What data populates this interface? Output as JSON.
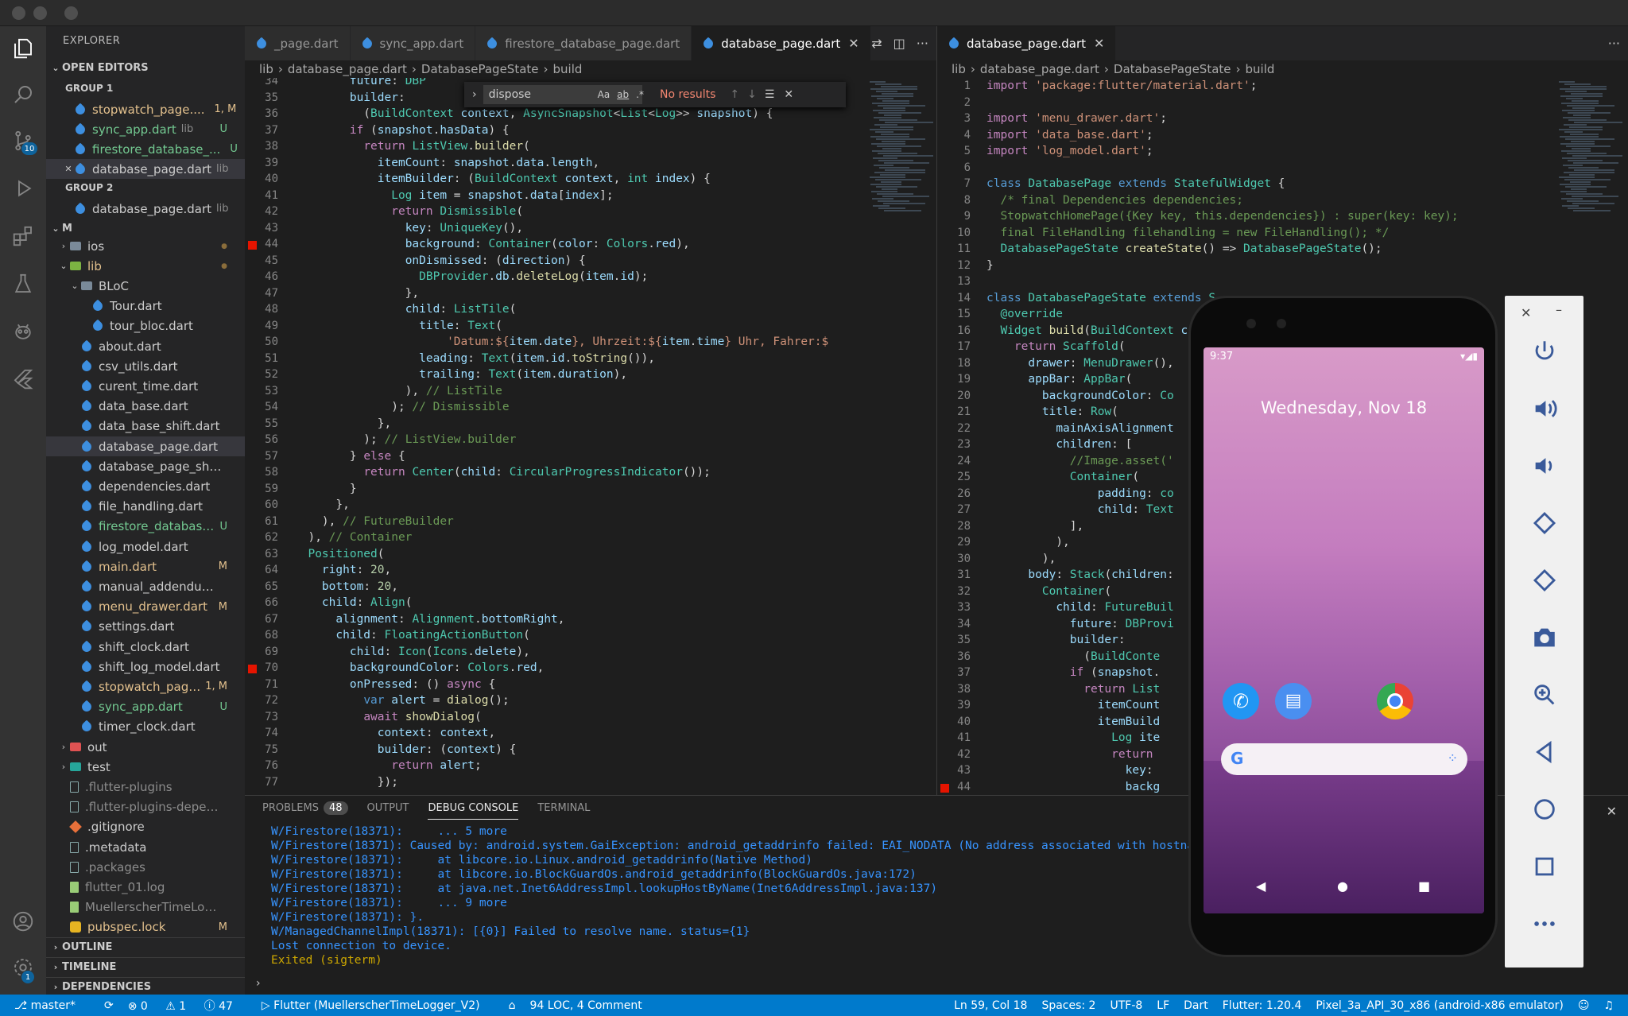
{
  "explorer": {
    "title": "EXPLORER",
    "open_editors": "OPEN EDITORS",
    "group1": "GROUP 1",
    "group2": "GROUP 2",
    "root": "M",
    "open_g1": [
      {
        "label": "stopwatch_page....",
        "desc": "",
        "badge": "1, M",
        "color": "mod",
        "close": false
      },
      {
        "label": "sync_app.dart",
        "desc": "lib",
        "badge": "U",
        "color": "un",
        "close": false
      },
      {
        "label": "firestore_database_...",
        "desc": "",
        "badge": "U",
        "color": "un",
        "close": false
      },
      {
        "label": "database_page.dart",
        "desc": "lib",
        "badge": "",
        "color": "",
        "close": true
      }
    ],
    "open_g2": [
      {
        "label": "database_page.dart",
        "desc": "lib"
      }
    ],
    "tree": [
      {
        "label": "ios",
        "icon": "folder",
        "indent": 1,
        "tw": "›",
        "badge": "●",
        "color": ""
      },
      {
        "label": "lib",
        "icon": "folderg",
        "indent": 1,
        "tw": "⌄",
        "badge": "●",
        "color": "mod"
      },
      {
        "label": "BLoC",
        "icon": "folder",
        "indent": 2,
        "tw": "⌄",
        "badge": "",
        "color": ""
      },
      {
        "label": "Tour.dart",
        "icon": "dart",
        "indent": 3,
        "badge": "",
        "color": ""
      },
      {
        "label": "tour_bloc.dart",
        "icon": "dart",
        "indent": 3,
        "badge": "",
        "color": ""
      },
      {
        "label": "about.dart",
        "icon": "dart",
        "indent": 2,
        "badge": "",
        "color": ""
      },
      {
        "label": "csv_utils.dart",
        "icon": "dart",
        "indent": 2,
        "badge": "",
        "color": ""
      },
      {
        "label": "curent_time.dart",
        "icon": "dart",
        "indent": 2,
        "badge": "",
        "color": ""
      },
      {
        "label": "data_base.dart",
        "icon": "dart",
        "indent": 2,
        "badge": "",
        "color": ""
      },
      {
        "label": "data_base_shift.dart",
        "icon": "dart",
        "indent": 2,
        "badge": "",
        "color": ""
      },
      {
        "label": "database_page.dart",
        "icon": "dart",
        "indent": 2,
        "badge": "",
        "color": "",
        "sel": true
      },
      {
        "label": "database_page_shift.dart",
        "icon": "dart",
        "indent": 2,
        "badge": "",
        "color": ""
      },
      {
        "label": "dependencies.dart",
        "icon": "dart",
        "indent": 2,
        "badge": "",
        "color": ""
      },
      {
        "label": "file_handling.dart",
        "icon": "dart",
        "indent": 2,
        "badge": "",
        "color": ""
      },
      {
        "label": "firestore_database...",
        "icon": "dart",
        "indent": 2,
        "badge": "U",
        "color": "un"
      },
      {
        "label": "log_model.dart",
        "icon": "dart",
        "indent": 2,
        "badge": "",
        "color": ""
      },
      {
        "label": "main.dart",
        "icon": "dart",
        "indent": 2,
        "badge": "M",
        "color": "mod"
      },
      {
        "label": "manual_addendum.dart",
        "icon": "dart",
        "indent": 2,
        "badge": "",
        "color": ""
      },
      {
        "label": "menu_drawer.dart",
        "icon": "dart",
        "indent": 2,
        "badge": "M",
        "color": "mod"
      },
      {
        "label": "settings.dart",
        "icon": "dart",
        "indent": 2,
        "badge": "",
        "color": ""
      },
      {
        "label": "shift_clock.dart",
        "icon": "dart",
        "indent": 2,
        "badge": "",
        "color": ""
      },
      {
        "label": "shift_log_model.dart",
        "icon": "dart",
        "indent": 2,
        "badge": "",
        "color": ""
      },
      {
        "label": "stopwatch_page....",
        "icon": "dart",
        "indent": 2,
        "badge": "1, M",
        "color": "mod"
      },
      {
        "label": "sync_app.dart",
        "icon": "dart",
        "indent": 2,
        "badge": "U",
        "color": "un"
      },
      {
        "label": "timer_clock.dart",
        "icon": "dart",
        "indent": 2,
        "badge": "",
        "color": ""
      },
      {
        "label": "out",
        "icon": "folderr",
        "indent": 1,
        "tw": "›",
        "badge": "",
        "color": ""
      },
      {
        "label": "test",
        "icon": "foldert",
        "indent": 1,
        "tw": "›",
        "badge": "",
        "color": ""
      },
      {
        "label": ".flutter-plugins",
        "icon": "file",
        "indent": 1,
        "badge": "",
        "color": "dim"
      },
      {
        "label": ".flutter-plugins-depende...",
        "icon": "file",
        "indent": 1,
        "badge": "",
        "color": "dim"
      },
      {
        "label": ".gitignore",
        "icon": "git",
        "indent": 1,
        "badge": "",
        "color": ""
      },
      {
        "label": ".metadata",
        "icon": "file",
        "indent": 1,
        "badge": "",
        "color": ""
      },
      {
        "label": ".packages",
        "icon": "file",
        "indent": 1,
        "badge": "",
        "color": "dim"
      },
      {
        "label": "flutter_01.log",
        "icon": "txt",
        "indent": 1,
        "badge": "",
        "color": "dim"
      },
      {
        "label": "MuellerscherTimeLogger....",
        "icon": "txt",
        "indent": 1,
        "badge": "",
        "color": "dim"
      },
      {
        "label": "pubspec.lock",
        "icon": "lock",
        "indent": 1,
        "badge": "M",
        "color": "mod"
      }
    ],
    "outline": "OUTLINE",
    "timeline": "TIMELINE",
    "dependencies": "DEPENDENCIES"
  },
  "tabs_left": [
    {
      "label": "_page.dart",
      "active": false
    },
    {
      "label": "sync_app.dart",
      "active": false
    },
    {
      "label": "firestore_database_page.dart",
      "active": false
    },
    {
      "label": "database_page.dart",
      "active": true
    }
  ],
  "tabs_right": [
    {
      "label": "database_page.dart",
      "active": true
    }
  ],
  "breadcrumb_left": [
    "lib",
    "database_page.dart",
    "DatabasePageState",
    "build"
  ],
  "breadcrumb_right": [
    "lib",
    "database_page.dart",
    "DatabasePageState",
    "build"
  ],
  "find": {
    "value": "dispose",
    "result": "No results",
    "aa": "Aa",
    "ab": "ab",
    "rx": ".*"
  },
  "left_lines": [
    {
      "n": "34",
      "h": "        <span class='pr'>future</span>: <span class='ty'>DBP</span>"
    },
    {
      "n": "35",
      "h": "        <span class='pr'>builder</span>:"
    },
    {
      "n": "36",
      "h": "          (<span class='ty'>BuildContext</span> <span class='pr'>context</span>, <span class='ty'>AsyncSnapshot</span>&lt;<span class='ty'>List</span>&lt;<span class='ty'>Log</span>&gt;&gt; <span class='pr'>snapshot</span>) {"
    },
    {
      "n": "37",
      "h": "        <span class='ct'>if</span> (<span class='pr'>snapshot</span>.<span class='pr'>hasData</span>) {"
    },
    {
      "n": "38",
      "h": "          <span class='ct'>return</span> <span class='ty'>ListView</span>.<span class='fn'>builder</span>("
    },
    {
      "n": "39",
      "h": "            <span class='pr'>itemCount</span>: <span class='pr'>snapshot</span>.<span class='pr'>data</span>.<span class='pr'>length</span>,"
    },
    {
      "n": "40",
      "h": "            <span class='pr'>itemBuilder</span>: (<span class='ty'>BuildContext</span> <span class='pr'>context</span>, <span class='ty'>int</span> <span class='pr'>index</span>) {"
    },
    {
      "n": "41",
      "h": "              <span class='ty'>Log</span> <span class='pr'>item</span> = <span class='pr'>snapshot</span>.<span class='pr'>data</span>[<span class='pr'>index</span>];"
    },
    {
      "n": "42",
      "h": "              <span class='ct'>return</span> <span class='ty'>Dismissible</span>("
    },
    {
      "n": "43",
      "h": "                <span class='pr'>key</span>: <span class='ty'>UniqueKey</span>(),"
    },
    {
      "n": "44",
      "h": "                <span class='pr'>background</span>: <span class='ty'>Container</span>(<span class='pr'>color</span>: <span class='ty'>Colors</span>.<span class='pr'>red</span>),"
    },
    {
      "n": "45",
      "h": "                <span class='pr'>onDismissed</span>: (<span class='pr'>direction</span>) {"
    },
    {
      "n": "46",
      "h": "                  <span class='ty'>DBProvider</span>.<span class='pr'>db</span>.<span class='fn'>deleteLog</span>(<span class='pr'>item</span>.<span class='pr'>id</span>);"
    },
    {
      "n": "47",
      "h": "                },"
    },
    {
      "n": "48",
      "h": "                <span class='pr'>child</span>: <span class='ty'>ListTile</span>("
    },
    {
      "n": "49",
      "h": "                  <span class='pr'>title</span>: <span class='ty'>Text</span>("
    },
    {
      "n": "50",
      "h": "                      <span class='st'>'Datum:${</span><span class='pr'>item</span>.<span class='pr'>date</span><span class='st'>}, Uhrzeit:${</span><span class='pr'>item</span>.<span class='pr'>time</span><span class='st'>} Uhr, Fahrer:$</span>"
    },
    {
      "n": "51",
      "h": "                  <span class='pr'>leading</span>: <span class='ty'>Text</span>(<span class='pr'>item</span>.<span class='pr'>id</span>.<span class='fn'>toString</span>()),"
    },
    {
      "n": "52",
      "h": "                  <span class='pr'>trailing</span>: <span class='ty'>Text</span>(<span class='pr'>item</span>.<span class='pr'>duration</span>),"
    },
    {
      "n": "53",
      "h": "                ), <span class='cm'>// ListTile</span>"
    },
    {
      "n": "54",
      "h": "              ); <span class='cm'>// Dismissible</span>"
    },
    {
      "n": "55",
      "h": "            },"
    },
    {
      "n": "56",
      "h": "          ); <span class='cm'>// ListView.builder</span>"
    },
    {
      "n": "57",
      "h": "        } <span class='ct'>else</span> {"
    },
    {
      "n": "58",
      "h": "          <span class='ct'>return</span> <span class='ty'>Center</span>(<span class='pr'>child</span>: <span class='ty'>CircularProgressIndicator</span>());"
    },
    {
      "n": "59",
      "h": "        }"
    },
    {
      "n": "60",
      "h": "      },"
    },
    {
      "n": "61",
      "h": "    ), <span class='cm'>// FutureBuilder</span>"
    },
    {
      "n": "62",
      "h": "  ), <span class='cm'>// Container</span>"
    },
    {
      "n": "63",
      "h": "  <span class='ty'>Positioned</span>("
    },
    {
      "n": "64",
      "h": "    <span class='pr'>right</span>: <span class='nm'>20</span>,"
    },
    {
      "n": "65",
      "h": "    <span class='pr'>bottom</span>: <span class='nm'>20</span>,"
    },
    {
      "n": "66",
      "h": "    <span class='pr'>child</span>: <span class='ty'>Align</span>("
    },
    {
      "n": "67",
      "h": "      <span class='pr'>alignment</span>: <span class='ty'>Alignment</span>.<span class='pr'>bottomRight</span>,"
    },
    {
      "n": "68",
      "h": "      <span class='pr'>child</span>: <span class='ty'>FloatingActionButton</span>("
    },
    {
      "n": "69",
      "h": "        <span class='pr'>child</span>: <span class='ty'>Icon</span>(<span class='ty'>Icons</span>.<span class='pr'>delete</span>),"
    },
    {
      "n": "70",
      "h": "        <span class='pr'>backgroundColor</span>: <span class='ty'>Colors</span>.<span class='pr'>red</span>,"
    },
    {
      "n": "71",
      "h": "        <span class='pr'>onPressed</span>: () <span class='ct'>async</span> {"
    },
    {
      "n": "72",
      "h": "          <span class='kw'>var</span> <span class='pr'>alert</span> = <span class='fn'>dialog</span>();"
    },
    {
      "n": "73",
      "h": "          <span class='ct'>await</span> <span class='fn'>showDialog</span>("
    },
    {
      "n": "74",
      "h": "            <span class='pr'>context</span>: <span class='pr'>context</span>,"
    },
    {
      "n": "75",
      "h": "            <span class='pr'>builder</span>: (<span class='pr'>context</span>) {"
    },
    {
      "n": "76",
      "h": "              <span class='ct'>return</span> <span class='pr'>alert</span>;"
    },
    {
      "n": "77",
      "h": "            });"
    }
  ],
  "right_lines": [
    {
      "n": "1",
      "h": "<span class='ct'>import</span> <span class='st'>'package:flutter/material.dart'</span>;"
    },
    {
      "n": "2",
      "h": ""
    },
    {
      "n": "3",
      "h": "<span class='ct'>import</span> <span class='st'>'menu_drawer.dart'</span>;"
    },
    {
      "n": "4",
      "h": "<span class='ct'>import</span> <span class='st'>'data_base.dart'</span>;"
    },
    {
      "n": "5",
      "h": "<span class='ct'>import</span> <span class='st'>'log_model.dart'</span>;"
    },
    {
      "n": "6",
      "h": ""
    },
    {
      "n": "7",
      "h": "<span class='kw'>class</span> <span class='ty'>DatabasePage</span> <span class='kw'>extends</span> <span class='ty'>StatefulWidget</span> {"
    },
    {
      "n": "8",
      "h": "  <span class='cm'>/* final Dependencies dependencies;</span>"
    },
    {
      "n": "9",
      "h": "<span class='cm'>  StopwatchHomePage({Key key, this.dependencies}) : super(key: key);</span>"
    },
    {
      "n": "10",
      "h": "<span class='cm'>  final FileHandling filehandling = new FileHandling(); */</span>"
    },
    {
      "n": "11",
      "h": "  <span class='ty'>DatabasePageState</span> <span class='fn'>createState</span>() =&gt; <span class='ty'>DatabasePageState</span>();"
    },
    {
      "n": "12",
      "h": "}"
    },
    {
      "n": "13",
      "h": ""
    },
    {
      "n": "14",
      "h": "<span class='kw'>class</span> <span class='ty'>DatabasePageState</span> <span class='kw'>extends</span> <span class='ty'>S</span>"
    },
    {
      "n": "15",
      "h": "  <span class='ty'>@override</span>"
    },
    {
      "n": "16",
      "h": "  <span class='ty'>Widget</span> <span class='fn'>build</span>(<span class='ty'>BuildContext</span> <span class='pr'>c</span>"
    },
    {
      "n": "17",
      "h": "    <span class='ct'>return</span> <span class='ty'>Scaffold</span>("
    },
    {
      "n": "18",
      "h": "      <span class='pr'>drawer</span>: <span class='ty'>MenuDrawer</span>(),"
    },
    {
      "n": "19",
      "h": "      <span class='pr'>appBar</span>: <span class='ty'>AppBar</span>("
    },
    {
      "n": "20",
      "h": "        <span class='pr'>backgroundColor</span>: <span class='ty'>Co</span>"
    },
    {
      "n": "21",
      "h": "        <span class='pr'>title</span>: <span class='ty'>Row</span>("
    },
    {
      "n": "22",
      "h": "          <span class='pr'>mainAxisAlignment</span>"
    },
    {
      "n": "23",
      "h": "          <span class='pr'>children</span>: ["
    },
    {
      "n": "24",
      "h": "            <span class='cm'>//Image.asset('</span>"
    },
    {
      "n": "25",
      "h": "            <span class='ty'>Container</span>("
    },
    {
      "n": "26",
      "h": "                <span class='pr'>padding</span>: <span class='ty'>co</span>"
    },
    {
      "n": "27",
      "h": "                <span class='pr'>child</span>: <span class='ty'>Text</span>"
    },
    {
      "n": "28",
      "h": "            ],"
    },
    {
      "n": "29",
      "h": "          ),"
    },
    {
      "n": "30",
      "h": "        ),"
    },
    {
      "n": "31",
      "h": "      <span class='pr'>body</span>: <span class='ty'>Stack</span>(<span class='pr'>children</span>:"
    },
    {
      "n": "32",
      "h": "        <span class='ty'>Container</span>("
    },
    {
      "n": "33",
      "h": "          <span class='pr'>child</span>: <span class='ty'>FutureBuil</span>"
    },
    {
      "n": "34",
      "h": "            <span class='pr'>future</span>: <span class='ty'>DBProvi</span>"
    },
    {
      "n": "35",
      "h": "            <span class='pr'>builder</span>:"
    },
    {
      "n": "36",
      "h": "              (<span class='ty'>BuildConte</span>"
    },
    {
      "n": "37",
      "h": "            <span class='ct'>if</span> (<span class='pr'>snapshot</span>."
    },
    {
      "n": "38",
      "h": "              <span class='ct'>return</span> <span class='ty'>List</span>"
    },
    {
      "n": "39",
      "h": "                <span class='pr'>itemCount</span>"
    },
    {
      "n": "40",
      "h": "                <span class='pr'>itemBuild</span>"
    },
    {
      "n": "41",
      "h": "                  <span class='ty'>Log</span> <span class='pr'>ite</span>"
    },
    {
      "n": "42",
      "h": "                  <span class='ct'>return</span>"
    },
    {
      "n": "43",
      "h": "                    <span class='pr'>key</span>:"
    },
    {
      "n": "44",
      "h": "                    <span class='pr'>backg</span>"
    }
  ],
  "panel": {
    "tabs": [
      "PROBLEMS",
      "OUTPUT",
      "DEBUG CONSOLE",
      "TERMINAL"
    ],
    "problems_count": "48",
    "lines": [
      {
        "t": "W/Firestore(18371):     ... 5 more",
        "c": "#3794ff"
      },
      {
        "t": "W/Firestore(18371): Caused by: android.system.GaiException: android_getaddrinfo failed: EAI_NODATA (No address associated with hostname)",
        "c": "#3794ff"
      },
      {
        "t": "W/Firestore(18371):     at libcore.io.Linux.android_getaddrinfo(Native Method)",
        "c": "#3794ff"
      },
      {
        "t": "W/Firestore(18371):     at libcore.io.BlockGuardOs.android_getaddrinfo(BlockGuardOs.java:172)",
        "c": "#3794ff"
      },
      {
        "t": "W/Firestore(18371):     at java.net.Inet6AddressImpl.lookupHostByName(Inet6AddressImpl.java:137)",
        "c": "#3794ff"
      },
      {
        "t": "W/Firestore(18371):     ... 9 more",
        "c": "#3794ff"
      },
      {
        "t": "W/Firestore(18371): }.",
        "c": "#3794ff"
      },
      {
        "t": "W/ManagedChannelImpl(18371): [{0}] Failed to resolve name. status={1}",
        "c": "#3794ff"
      },
      {
        "t": "Lost connection to device.",
        "c": "#3794ff"
      },
      {
        "t": "Exited (sigterm)",
        "c": "#cca700"
      }
    ]
  },
  "status": {
    "branch": "master*",
    "errors": "0",
    "warnings": "1",
    "info": "47",
    "launch": "Flutter (MuellerscherTimeLogger_V2)",
    "loc": "94 LOC, 4 Comment",
    "cursor": "Ln 59, Col 18",
    "spaces": "Spaces: 2",
    "enc": "UTF-8",
    "eol": "LF",
    "lang": "Dart",
    "flutter": "Flutter: 1.20.4",
    "device": "Pixel_3a_API_30_x86 (android-x86 emulator)"
  },
  "phone": {
    "time": "9:37",
    "date": "Wednesday, Nov 18"
  },
  "colors": {
    "accent": "#007acc",
    "sidebar": "#252526",
    "editor": "#1e1e1e",
    "modified": "#e2c08d",
    "untracked": "#73c991"
  }
}
